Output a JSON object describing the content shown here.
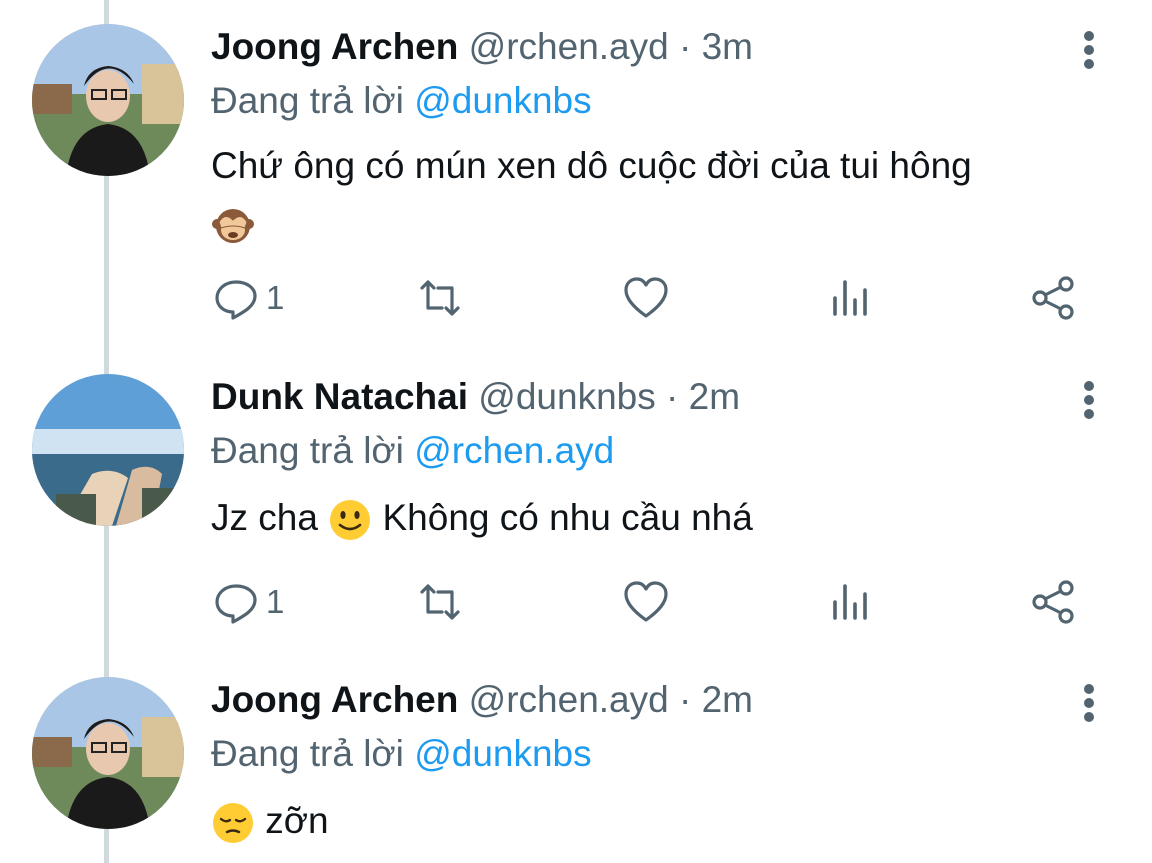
{
  "tweets": [
    {
      "name": "Joong Archen",
      "handle": "@rchen.ayd",
      "time": "3m",
      "reply_prefix": "Đang trả lời",
      "reply_to": "@dunknbs",
      "text": "Chứ ông có mún xen dô cuộc đời của tui hông",
      "emoji": "see-no-evil-monkey",
      "reply_count": "1",
      "avatar": "joong-avatar"
    },
    {
      "name": "Dunk Natachai",
      "handle": "@dunknbs",
      "time": "2m",
      "reply_prefix": "Đang trả lời",
      "reply_to": "@rchen.ayd",
      "text_before": "Jz cha",
      "text_after": "Không có nhu cầu nhá",
      "emoji": "slightly-smiling-face",
      "reply_count": "1",
      "avatar": "dunk-avatar"
    },
    {
      "name": "Joong Archen",
      "handle": "@rchen.ayd",
      "time": "2m",
      "reply_prefix": "Đang trả lời",
      "reply_to": "@dunknbs",
      "text": "zỡn",
      "emoji": "pensive-face",
      "avatar": "joong-avatar"
    }
  ],
  "separator": " · ",
  "colors": {
    "accent": "#1d9bf0",
    "secondary": "#536471",
    "thread_line": "#cfd9de"
  }
}
